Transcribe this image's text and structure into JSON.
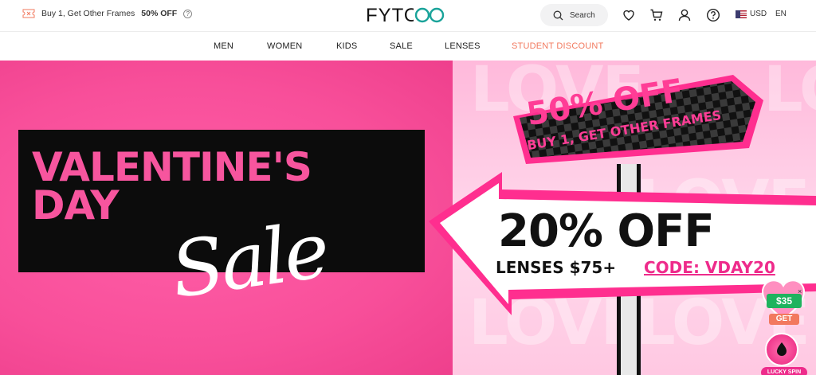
{
  "topbar": {
    "promo_text": "Buy 1, Get Other Frames",
    "promo_highlight": "50% OFF",
    "help_icon": "?",
    "logo": "FYTOO",
    "search_label": "Search",
    "currency": "USD",
    "language": "EN"
  },
  "nav": {
    "items": [
      "MEN",
      "WOMEN",
      "KIDS",
      "SALE",
      "LENSES",
      "STUDENT DISCOUNT"
    ]
  },
  "hero": {
    "title_line1": "VALENTINE'S",
    "title_line2": "DAY",
    "script": "Sale",
    "bg_word": "LOVE",
    "sign_line1": "50% OFF",
    "sign_line2": "BUY 1, GET OTHER FRAMES",
    "arrow_line1": "20% OFF",
    "arrow_line2": "LENSES $75+",
    "arrow_code": "CODE: VDAY20",
    "coupon_amount": "$35",
    "coupon_get": "GET",
    "coupon_close": "×",
    "lucky_spin": "LUCKY SPIN"
  },
  "colors": {
    "accent": "#f7559e",
    "nav_highlight": "#f2795e",
    "coupon_green": "#1fb35e"
  }
}
